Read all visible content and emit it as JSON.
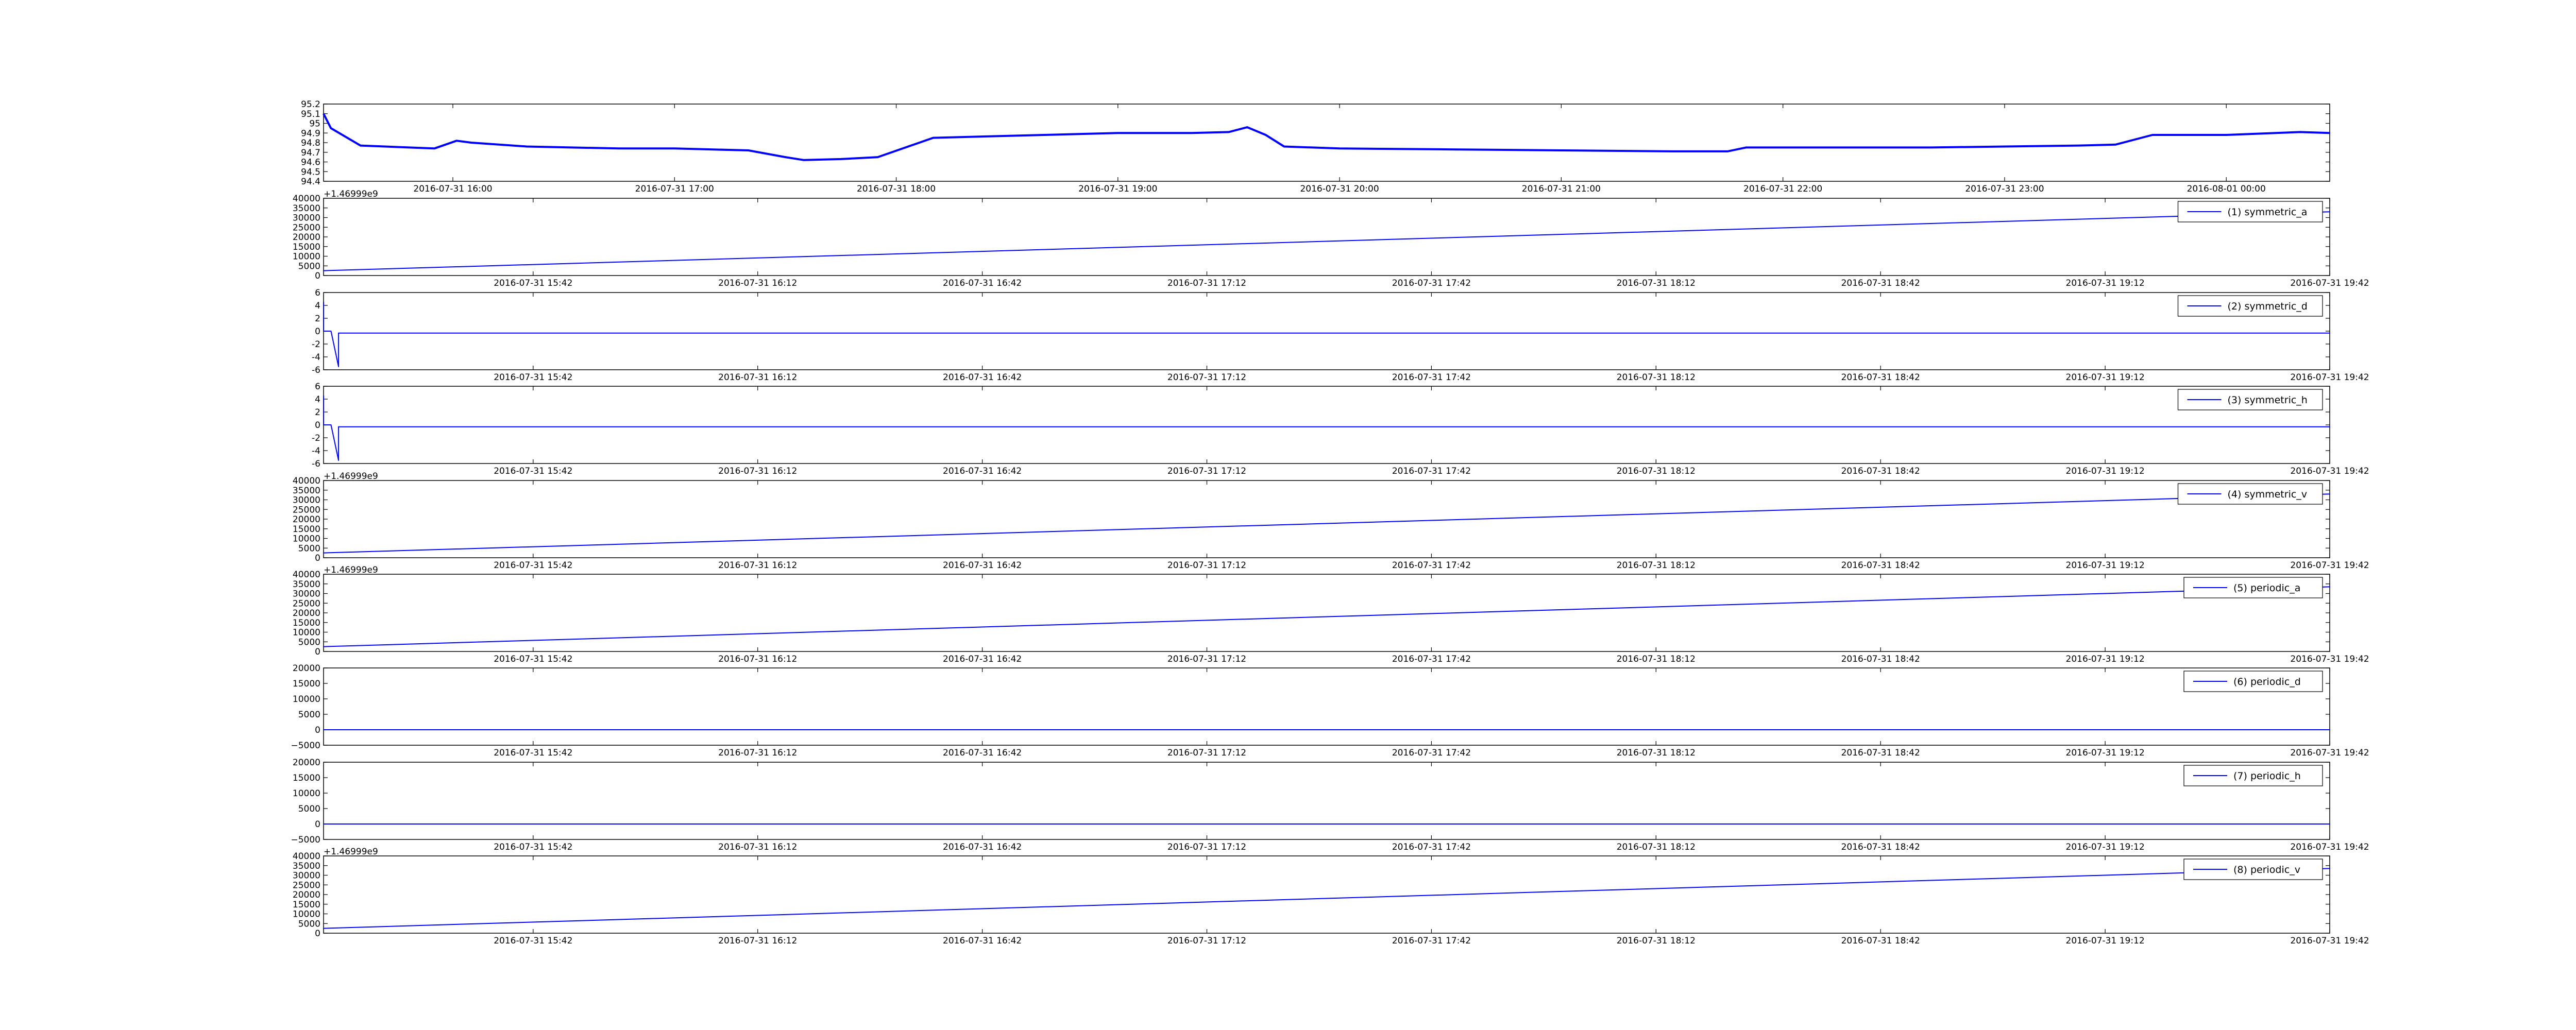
{
  "colors": {
    "series": "#0000ff",
    "axes": "#000000",
    "background": "#ffffff"
  },
  "chart_data": [
    {
      "type": "line",
      "title": "",
      "xlabel": "",
      "ylabel": "",
      "x_type": "time",
      "xlim": [
        "2016-07-31 15:25",
        "2016-08-01 00:28"
      ],
      "ylim": [
        94.4,
        95.2
      ],
      "yticks": [
        95.2,
        95.1,
        95.0,
        94.9,
        94.8,
        94.7,
        94.6,
        94.5,
        94.4
      ],
      "xticks": [
        "2016-07-31 16:00",
        "2016-07-31 17:00",
        "2016-07-31 18:00",
        "2016-07-31 19:00",
        "2016-07-31 20:00",
        "2016-07-31 21:00",
        "2016-07-31 22:00",
        "2016-07-31 23:00",
        "2016-08-01 00:00"
      ],
      "grid": false,
      "legend": null,
      "series": [
        {
          "x": [
            "2016-07-31 15:25",
            "2016-07-31 15:27",
            "2016-07-31 15:35",
            "2016-07-31 15:55",
            "2016-07-31 16:01",
            "2016-07-31 16:05",
            "2016-07-31 16:20",
            "2016-07-31 16:45",
            "2016-07-31 17:00",
            "2016-07-31 17:20",
            "2016-07-31 17:30",
            "2016-07-31 17:35",
            "2016-07-31 17:45",
            "2016-07-31 17:55",
            "2016-07-31 18:10",
            "2016-07-31 18:40",
            "2016-07-31 19:00",
            "2016-07-31 19:20",
            "2016-07-31 19:30",
            "2016-07-31 19:35",
            "2016-07-31 19:40",
            "2016-07-31 19:45",
            "2016-07-31 20:00",
            "2016-07-31 20:30",
            "2016-07-31 21:00",
            "2016-07-31 21:30",
            "2016-07-31 21:45",
            "2016-07-31 21:50",
            "2016-07-31 22:10",
            "2016-07-31 22:40",
            "2016-07-31 23:00",
            "2016-07-31 23:20",
            "2016-07-31 23:30",
            "2016-07-31 23:40",
            "2016-08-01 00:00",
            "2016-08-01 00:20",
            "2016-08-01 00:28"
          ],
          "y": [
            95.1,
            94.95,
            94.77,
            94.74,
            94.82,
            94.8,
            94.76,
            94.74,
            94.74,
            94.72,
            94.65,
            94.62,
            94.63,
            94.65,
            94.85,
            94.88,
            94.9,
            94.9,
            94.91,
            94.96,
            94.88,
            94.76,
            94.74,
            94.73,
            94.72,
            94.71,
            94.71,
            94.75,
            94.75,
            94.75,
            94.76,
            94.77,
            94.78,
            94.88,
            94.88,
            94.91,
            94.9
          ]
        }
      ]
    },
    {
      "type": "line",
      "xlabel": "",
      "ylabel": "",
      "x_type": "time",
      "xlim": [
        "2016-07-31 15:14",
        "2016-07-31 19:42"
      ],
      "ylim": [
        0,
        40000
      ],
      "yticks": [
        40000,
        35000,
        30000,
        25000,
        20000,
        15000,
        10000,
        5000,
        0
      ],
      "offset_label": "+1.46999e9",
      "xticks": [
        "2016-07-31 15:42",
        "2016-07-31 16:12",
        "2016-07-31 16:42",
        "2016-07-31 17:12",
        "2016-07-31 17:42",
        "2016-07-31 18:12",
        "2016-07-31 18:42",
        "2016-07-31 19:12",
        "2016-07-31 19:42"
      ],
      "grid": false,
      "legend": "top-right",
      "series": [
        {
          "name": "(1) symmetric_a",
          "x": [
            "2016-07-31 15:14",
            "2016-07-31 19:42"
          ],
          "y": [
            2500,
            33000
          ]
        }
      ]
    },
    {
      "type": "line",
      "xlabel": "",
      "ylabel": "",
      "x_type": "time",
      "xlim": [
        "2016-07-31 15:14",
        "2016-07-31 19:42"
      ],
      "ylim": [
        -6,
        6
      ],
      "yticks": [
        6,
        4,
        2,
        0,
        -2,
        -4,
        -6
      ],
      "xticks": [
        "2016-07-31 15:42",
        "2016-07-31 16:12",
        "2016-07-31 16:42",
        "2016-07-31 17:12",
        "2016-07-31 17:42",
        "2016-07-31 18:12",
        "2016-07-31 18:42",
        "2016-07-31 19:12",
        "2016-07-31 19:42"
      ],
      "grid": false,
      "legend": "top-right",
      "series": [
        {
          "name": "(2) symmetric_d",
          "x": [
            "2016-07-31 15:14",
            "2016-07-31 15:14",
            "2016-07-31 15:15",
            "2016-07-31 15:16",
            "2016-07-31 15:16",
            "2016-07-31 19:42"
          ],
          "y": [
            4.5,
            0,
            0,
            -5.5,
            -0.3,
            -0.3
          ]
        }
      ]
    },
    {
      "type": "line",
      "xlabel": "",
      "ylabel": "",
      "x_type": "time",
      "xlim": [
        "2016-07-31 15:14",
        "2016-07-31 19:42"
      ],
      "ylim": [
        -6,
        6
      ],
      "yticks": [
        6,
        4,
        2,
        0,
        -2,
        -4,
        -6
      ],
      "xticks": [
        "2016-07-31 15:42",
        "2016-07-31 16:12",
        "2016-07-31 16:42",
        "2016-07-31 17:12",
        "2016-07-31 17:42",
        "2016-07-31 18:12",
        "2016-07-31 18:42",
        "2016-07-31 19:12",
        "2016-07-31 19:42"
      ],
      "grid": false,
      "legend": "top-right",
      "series": [
        {
          "name": "(3) symmetric_h",
          "x": [
            "2016-07-31 15:14",
            "2016-07-31 15:14",
            "2016-07-31 15:15",
            "2016-07-31 15:16",
            "2016-07-31 15:16",
            "2016-07-31 19:42"
          ],
          "y": [
            4.5,
            0,
            0,
            -5.5,
            -0.3,
            -0.3
          ]
        }
      ]
    },
    {
      "type": "line",
      "xlabel": "",
      "ylabel": "",
      "x_type": "time",
      "xlim": [
        "2016-07-31 15:14",
        "2016-07-31 19:42"
      ],
      "ylim": [
        0,
        40000
      ],
      "yticks": [
        40000,
        35000,
        30000,
        25000,
        20000,
        15000,
        10000,
        5000,
        0
      ],
      "offset_label": "+1.46999e9",
      "xticks": [
        "2016-07-31 15:42",
        "2016-07-31 16:12",
        "2016-07-31 16:42",
        "2016-07-31 17:12",
        "2016-07-31 17:42",
        "2016-07-31 18:12",
        "2016-07-31 18:42",
        "2016-07-31 19:12",
        "2016-07-31 19:42"
      ],
      "grid": false,
      "legend": "top-right",
      "series": [
        {
          "name": "(4) symmetric_v",
          "x": [
            "2016-07-31 15:14",
            "2016-07-31 19:42"
          ],
          "y": [
            2500,
            33000
          ]
        }
      ]
    },
    {
      "type": "line",
      "xlabel": "",
      "ylabel": "",
      "x_type": "time",
      "xlim": [
        "2016-07-31 15:14",
        "2016-07-31 19:42"
      ],
      "ylim": [
        0,
        40000
      ],
      "yticks": [
        40000,
        35000,
        30000,
        25000,
        20000,
        15000,
        10000,
        5000,
        0
      ],
      "offset_label": "+1.46999e9",
      "xticks": [
        "2016-07-31 15:42",
        "2016-07-31 16:12",
        "2016-07-31 16:42",
        "2016-07-31 17:12",
        "2016-07-31 17:42",
        "2016-07-31 18:12",
        "2016-07-31 18:42",
        "2016-07-31 19:12",
        "2016-07-31 19:42"
      ],
      "grid": false,
      "legend": "top-right",
      "series": [
        {
          "name": "(5) periodic_a",
          "x": [
            "2016-07-31 15:14",
            "2016-07-31 19:42"
          ],
          "y": [
            2500,
            33500
          ]
        }
      ]
    },
    {
      "type": "line",
      "xlabel": "",
      "ylabel": "",
      "x_type": "time",
      "xlim": [
        "2016-07-31 15:14",
        "2016-07-31 19:42"
      ],
      "ylim": [
        -5000,
        20000
      ],
      "yticks": [
        20000,
        15000,
        10000,
        5000,
        0,
        -5000
      ],
      "ytick_labels": [
        "20000",
        "15000",
        "10000",
        "5000",
        "0",
        "−5000"
      ],
      "xticks": [
        "2016-07-31 15:42",
        "2016-07-31 16:12",
        "2016-07-31 16:42",
        "2016-07-31 17:12",
        "2016-07-31 17:42",
        "2016-07-31 18:12",
        "2016-07-31 18:42",
        "2016-07-31 19:12",
        "2016-07-31 19:42"
      ],
      "grid": false,
      "legend": "top-right",
      "series": [
        {
          "name": "(6) periodic_d",
          "x": [
            "2016-07-31 15:14",
            "2016-07-31 19:42"
          ],
          "y": [
            0,
            0
          ]
        }
      ]
    },
    {
      "type": "line",
      "xlabel": "",
      "ylabel": "",
      "x_type": "time",
      "xlim": [
        "2016-07-31 15:14",
        "2016-07-31 19:42"
      ],
      "ylim": [
        -5000,
        20000
      ],
      "yticks": [
        20000,
        15000,
        10000,
        5000,
        0,
        -5000
      ],
      "ytick_labels": [
        "20000",
        "15000",
        "10000",
        "5000",
        "0",
        "−5000"
      ],
      "xticks": [
        "2016-07-31 15:42",
        "2016-07-31 16:12",
        "2016-07-31 16:42",
        "2016-07-31 17:12",
        "2016-07-31 17:42",
        "2016-07-31 18:12",
        "2016-07-31 18:42",
        "2016-07-31 19:12",
        "2016-07-31 19:42"
      ],
      "grid": false,
      "legend": "top-right",
      "series": [
        {
          "name": "(7) periodic_h",
          "x": [
            "2016-07-31 15:14",
            "2016-07-31 19:42"
          ],
          "y": [
            0,
            0
          ]
        }
      ]
    },
    {
      "type": "line",
      "xlabel": "",
      "ylabel": "",
      "x_type": "time",
      "xlim": [
        "2016-07-31 15:14",
        "2016-07-31 19:42"
      ],
      "ylim": [
        0,
        40000
      ],
      "yticks": [
        40000,
        35000,
        30000,
        25000,
        20000,
        15000,
        10000,
        5000,
        0
      ],
      "offset_label": "+1.46999e9",
      "xticks": [
        "2016-07-31 15:42",
        "2016-07-31 16:12",
        "2016-07-31 16:42",
        "2016-07-31 17:12",
        "2016-07-31 17:42",
        "2016-07-31 18:12",
        "2016-07-31 18:42",
        "2016-07-31 19:12",
        "2016-07-31 19:42"
      ],
      "grid": false,
      "legend": "top-right",
      "series": [
        {
          "name": "(8) periodic_v",
          "x": [
            "2016-07-31 15:14",
            "2016-07-31 19:42"
          ],
          "y": [
            2500,
            33500
          ]
        }
      ]
    }
  ]
}
